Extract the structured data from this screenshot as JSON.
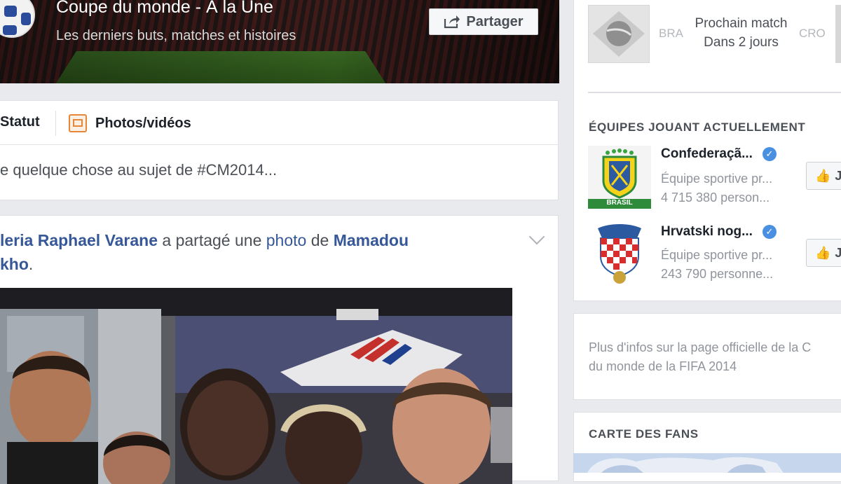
{
  "cover": {
    "title": "Coupe du monde - À la Une",
    "subtitle": "Les derniers buts, matches et histoires",
    "share_label": "Partager",
    "share_icon": "share-arrow-icon"
  },
  "composer": {
    "tab_status": "Statut",
    "tab_photos": "Photos/vidéos",
    "photo_icon": "photo-icon",
    "input_placeholder": "e quelque chose au sujet de #CM2014..."
  },
  "post": {
    "actor": "leria Raphael Varane",
    "action_1": " a partagé une ",
    "object": "photo",
    "action_2": " de ",
    "owner_1": "Mamadou",
    "owner_2": "kho",
    "end": "."
  },
  "next_match": {
    "team_left": "BRA",
    "team_right": "CRO",
    "label": "Prochain match",
    "when": "Dans 2 jours"
  },
  "teams_playing": {
    "heading": "ÉQUIPES JOUANT ACTUELLEMENT",
    "teams": [
      {
        "name": "Confederaçã...",
        "category": "Équipe sportive pr...",
        "fans": "4 715 380 person...",
        "crest_text": "BRASIL"
      },
      {
        "name": "Hrvatski nog...",
        "category": "Équipe sportive pr...",
        "fans": "243 790 personne..."
      }
    ],
    "like_label": "J"
  },
  "info": {
    "line1": "Plus d'infos sur la page officielle de la C",
    "line2": "du monde de la FIFA 2014"
  },
  "fan_map": {
    "heading": "CARTE DES FANS"
  },
  "colors": {
    "link": "#365899",
    "verified": "#4a90e2",
    "background": "#e9eaed",
    "photo_accent": "#e4873b"
  }
}
